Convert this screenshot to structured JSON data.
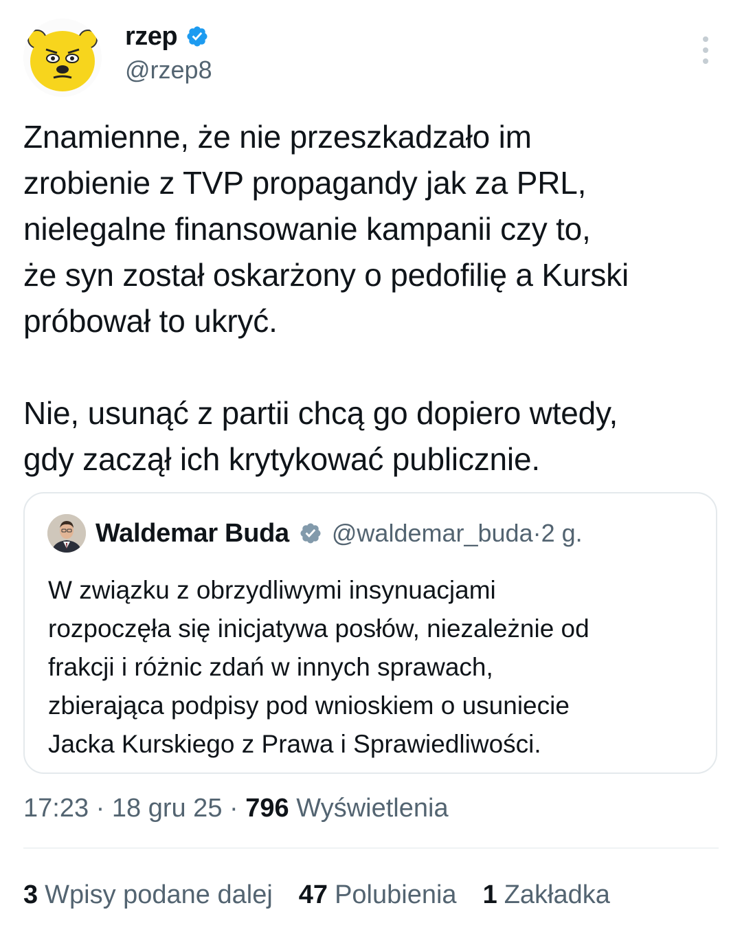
{
  "author": {
    "display_name": "rzep",
    "handle": "@rzep8",
    "avatar_icon": "yellow-bear-avatar",
    "verified_icon": "verified-badge-blue"
  },
  "menu_icon": "more-vertical-icon",
  "tweet": {
    "text": "Znamienne, że nie przeszkadzało im\nzrobienie z TVP propagandy jak za PRL,\nnielegalne finansowanie kampanii czy to,\nże syn został oskarżony o pedofilię a Kurski\npróbował to ukryć.\n\nNie, usunąć z partii chcą go dopiero wtedy,\ngdy zaczął ich krytykować publicznie."
  },
  "quoted": {
    "display_name": "Waldemar Buda",
    "handle": "@waldemar_buda",
    "separator": " · ",
    "age": "2 g.",
    "verified_icon": "verified-badge-gray",
    "text": "W związku z obrzydliwymi insynuacjami\nrozpoczęła się inicjatywa posłów, niezależnie od\nfrakcji i różnic zdań w innych sprawach,\nzbierająca podpisy pod wnioskiem o usuniecie\nJacka Kurskiego z Prawa i Sprawiedliwości."
  },
  "meta": {
    "time": "17:23",
    "sep1": " · ",
    "date": "18 gru 25",
    "sep2": " · ",
    "views_count": "796",
    "views_label": "Wyświetlenia"
  },
  "stats": [
    {
      "count": "3",
      "label": "Wpisy podane dalej"
    },
    {
      "count": "47",
      "label": "Polubienia"
    },
    {
      "count": "1",
      "label": "Zakładka"
    }
  ],
  "colors": {
    "verified_blue": "#1d9bf0",
    "verified_gray": "#829aab",
    "secondary_text": "#536471",
    "avatar_yellow": "#f7d51d"
  }
}
